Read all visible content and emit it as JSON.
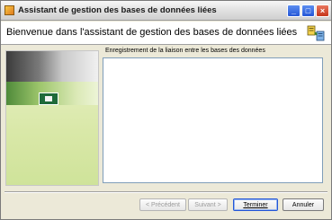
{
  "window": {
    "title": "Assistant de gestion des bases de données liées",
    "controls": {
      "minimize": "_",
      "maximize": "□",
      "close": "×"
    }
  },
  "header": {
    "title": "Bienvenue dans l'assistant de gestion des bases de données liées",
    "icon": "database-link-icon"
  },
  "main": {
    "section_label": "Enregistrement de la liaison entre les bases des données",
    "log_text": ""
  },
  "buttons": {
    "back": "< Précédent",
    "next": "Suivant >",
    "finish": "Terminer",
    "cancel": "Annuler"
  },
  "colors": {
    "title_active": "#2456d6",
    "close": "#c6351a",
    "side_panel": "#d9e8a8"
  }
}
